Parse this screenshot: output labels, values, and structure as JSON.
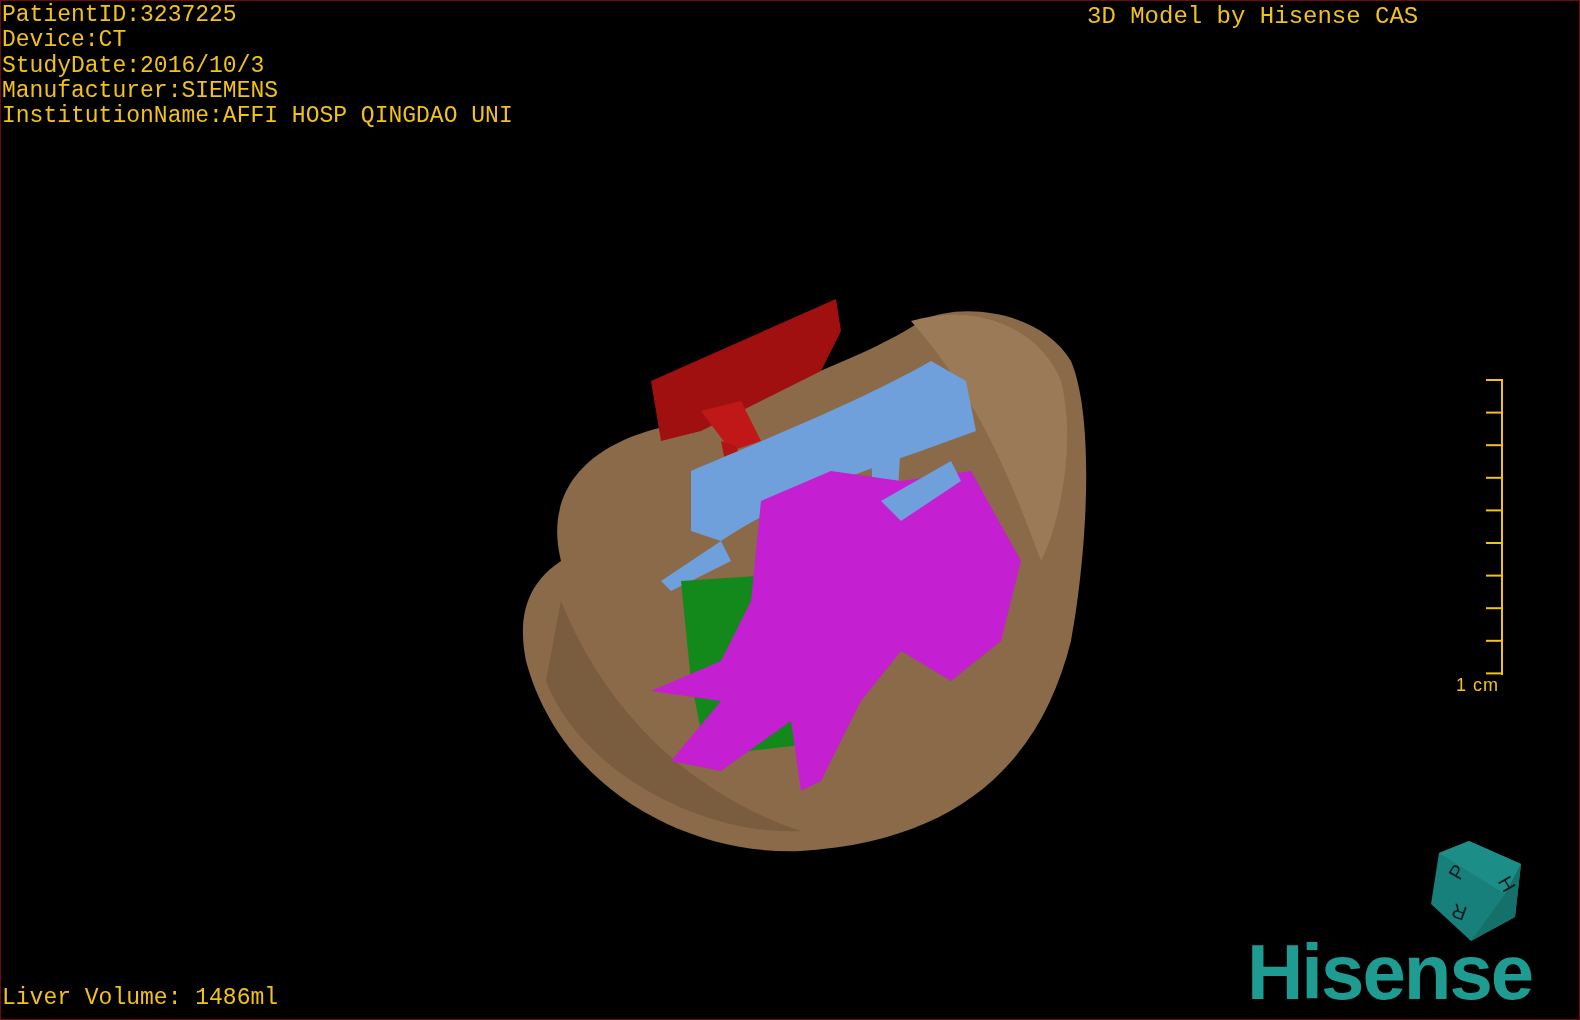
{
  "patient_info": [
    "PatientID:3237225",
    "Device:CT",
    "StudyDate:2016/10/3",
    "Manufacturer:SIEMENS",
    "InstitutionName:AFFI HOSP QINGDAO UNI"
  ],
  "model_credit": "3D Model by Hisense CAS",
  "scale_bar": {
    "label": "1 cm"
  },
  "orientation_cube": {
    "labels": [
      "P",
      "H",
      "R"
    ]
  },
  "logo": "Hisense",
  "liver_volume": "Liver Volume: 1486ml"
}
